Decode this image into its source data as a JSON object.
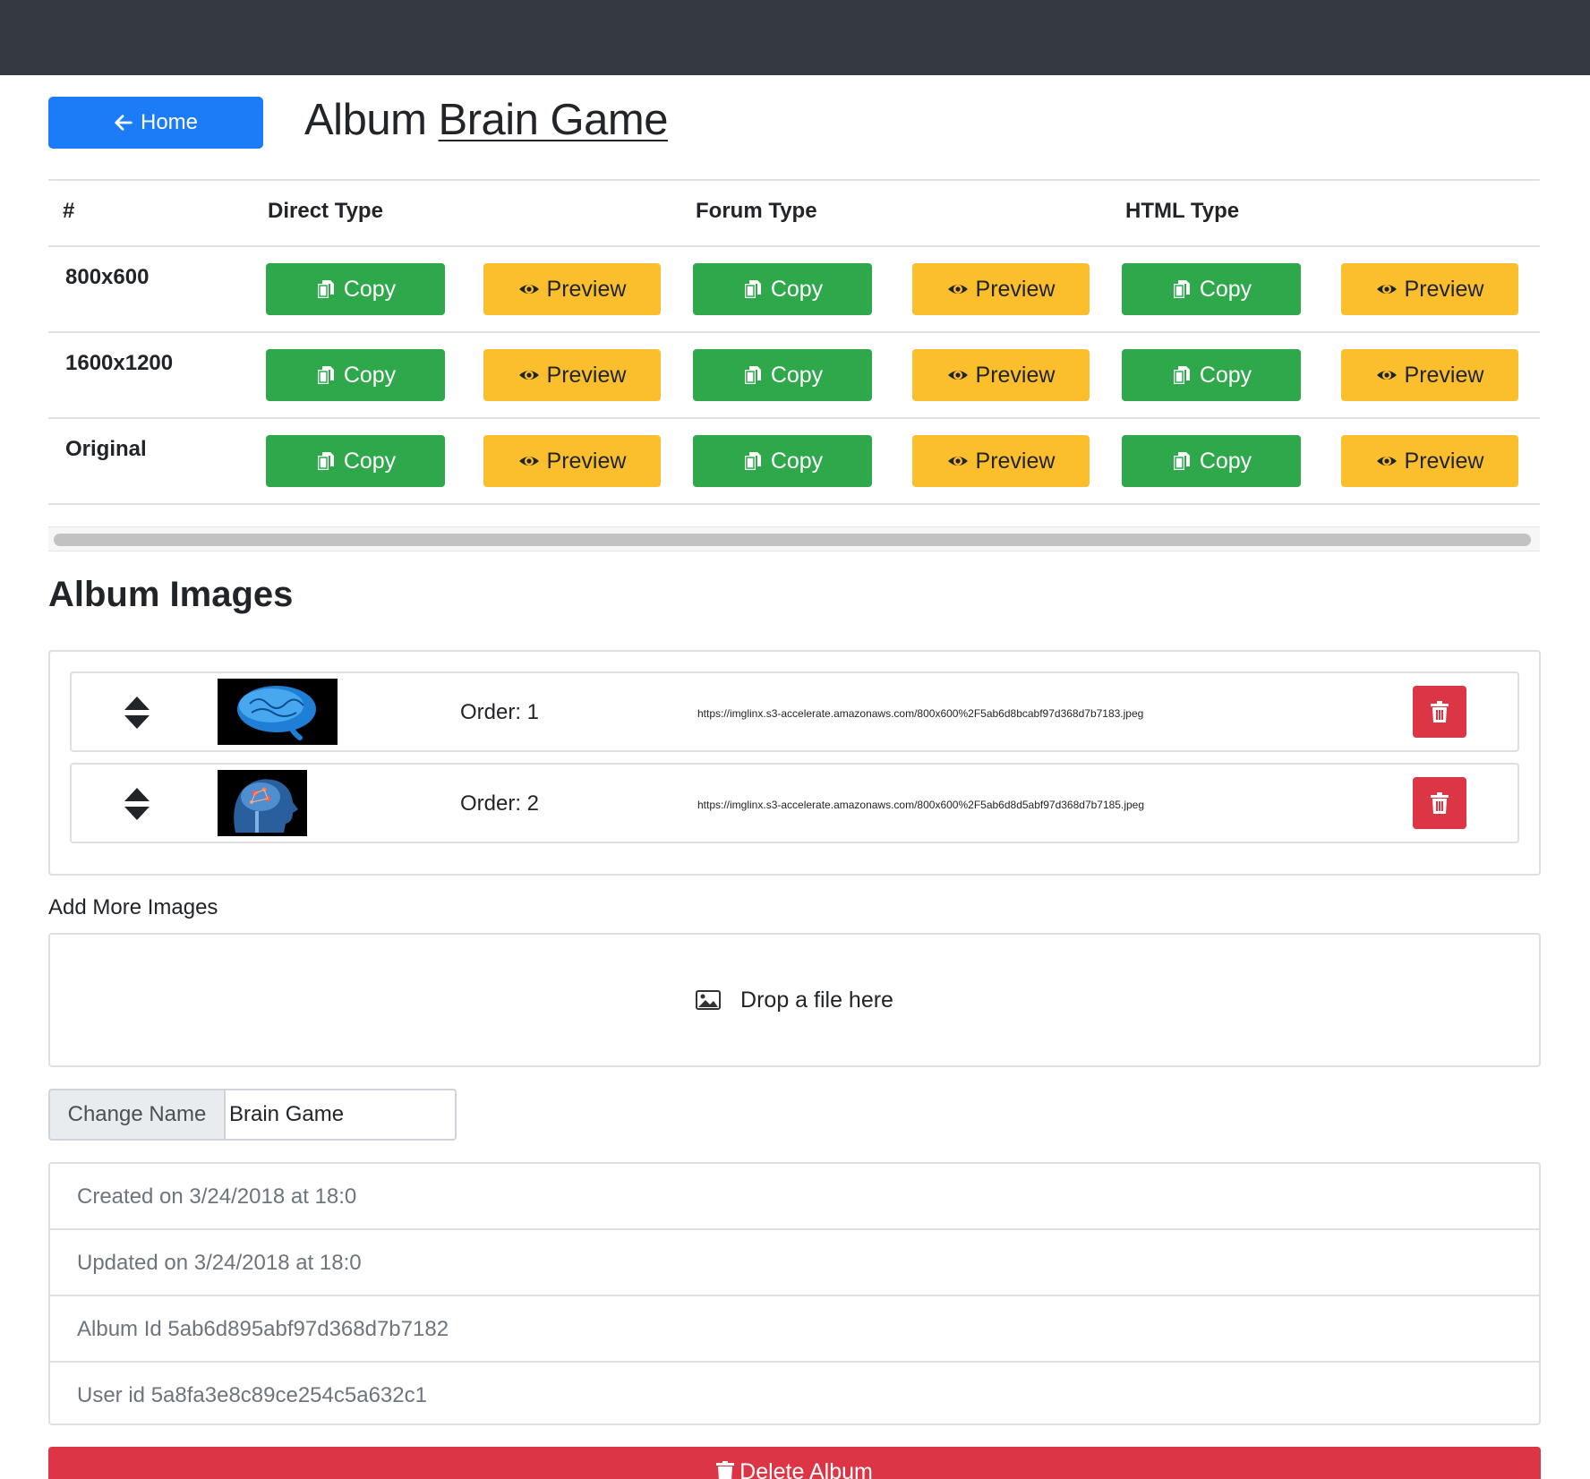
{
  "header": {
    "home_label": "Home",
    "title_prefix": "Album",
    "album_name": "Brain Game"
  },
  "links_table": {
    "headers": {
      "index": "#",
      "direct": "Direct Type",
      "forum": "Forum Type",
      "html": "HTML Type"
    },
    "rows": [
      {
        "label": "800x600"
      },
      {
        "label": "1600x1200"
      },
      {
        "label": "Original"
      }
    ],
    "copy_label": "Copy",
    "preview_label": "Preview"
  },
  "album_images": {
    "title": "Album Images",
    "items": [
      {
        "order": "Order: 1",
        "url": "https://imglinx.s3-accelerate.amazonaws.com/800x600%2F5ab6d8bcabf97d368d7b7183.jpeg"
      },
      {
        "order": "Order: 2",
        "url": "https://imglinx.s3-accelerate.amazonaws.com/800x600%2F5ab6d8d5abf97d368d7b7185.jpeg"
      }
    ]
  },
  "upload": {
    "label": "Add More Images",
    "dropzone_text": "Drop a file here"
  },
  "rename": {
    "addon_label": "Change Name",
    "value": "Brain Game"
  },
  "info": {
    "created": "Created on 3/24/2018 at 18:0",
    "updated": "Updated on 3/24/2018 at 18:0",
    "album_id": "Album Id 5ab6d895abf97d368d7b7182",
    "user_id": "User id 5a8fa3e8c89ce254c5a632c1"
  },
  "delete_label": "Delete Album",
  "colors": {
    "topbar": "#343a40",
    "primary": "#1c7cf8",
    "success": "#2fa84b",
    "warning": "#fbbf2d",
    "danger": "#dc3545"
  },
  "icons": [
    "arrow-left-icon",
    "copy-icon",
    "eye-icon",
    "sort-icon",
    "trash-icon",
    "image-icon"
  ]
}
